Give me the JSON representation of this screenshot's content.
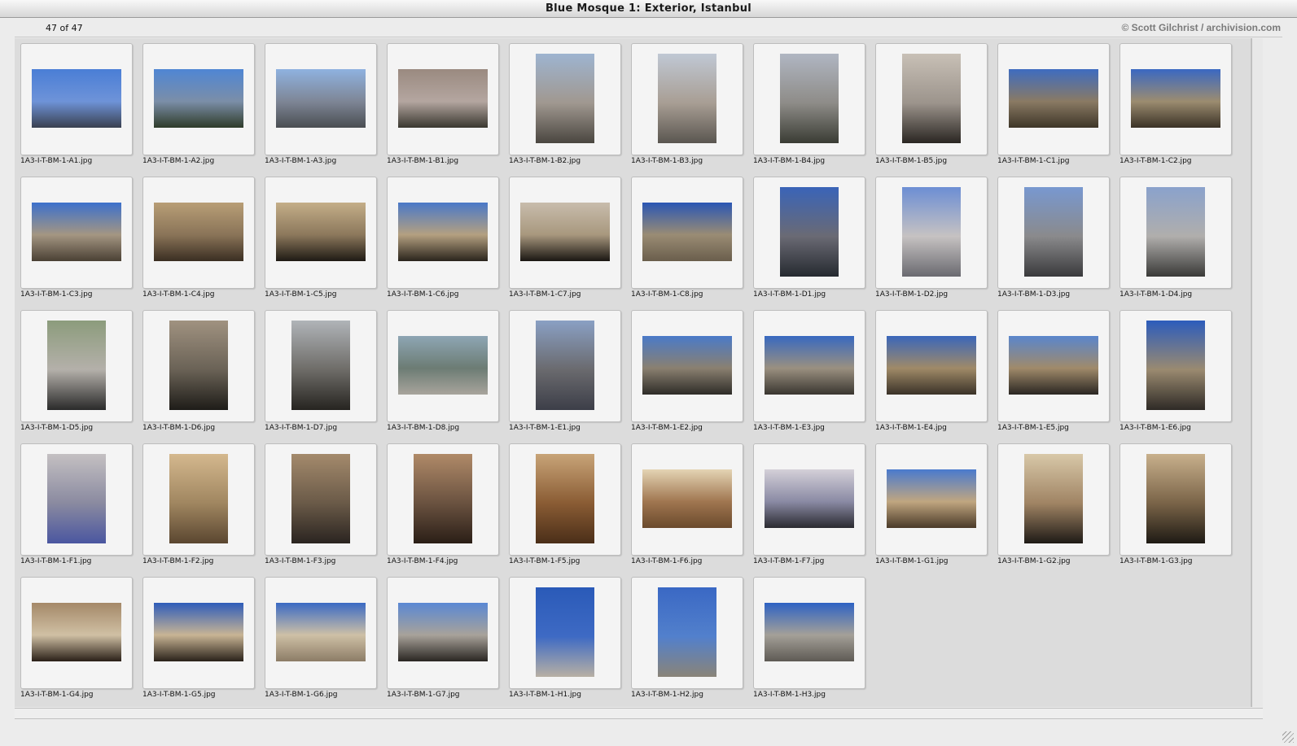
{
  "window": {
    "title": "Blue Mosque 1: Exterior, Istanbul"
  },
  "info": {
    "count": "47 of 47",
    "credit": "© Scott Gilchrist / archivision.com"
  },
  "colors": {
    "sky_blue": "#3f6fc4",
    "stone": "#b09a78",
    "shadow": "#2e2a24",
    "pale_sky": "#a8c4e0"
  },
  "thumbnails": [
    {
      "file": "1A3-I-T-BM-1-A1.jpg",
      "orientation": "landscape",
      "palette": [
        "#4a7ed6",
        "#6e93d8",
        "#3a4050"
      ]
    },
    {
      "file": "1A3-I-T-BM-1-A2.jpg",
      "orientation": "landscape",
      "palette": [
        "#4f86d4",
        "#7b8ea8",
        "#2f3c2a"
      ]
    },
    {
      "file": "1A3-I-T-BM-1-A3.jpg",
      "orientation": "landscape",
      "palette": [
        "#8fb2e0",
        "#7e8696",
        "#4a4e52"
      ]
    },
    {
      "file": "1A3-I-T-BM-1-B1.jpg",
      "orientation": "landscape",
      "palette": [
        "#9a8a80",
        "#b4a6a0",
        "#3a3830"
      ]
    },
    {
      "file": "1A3-I-T-BM-1-B2.jpg",
      "orientation": "portrait",
      "palette": [
        "#9eb4d0",
        "#a09890",
        "#4a4640"
      ]
    },
    {
      "file": "1A3-I-T-BM-1-B3.jpg",
      "orientation": "portrait",
      "palette": [
        "#c0c8d4",
        "#a89e94",
        "#5a5650"
      ]
    },
    {
      "file": "1A3-I-T-BM-1-B4.jpg",
      "orientation": "portrait",
      "palette": [
        "#b0b6c2",
        "#8e8c88",
        "#3a3c34"
      ]
    },
    {
      "file": "1A3-I-T-BM-1-B5.jpg",
      "orientation": "portrait",
      "palette": [
        "#c8c0b6",
        "#9c948c",
        "#2a2622"
      ]
    },
    {
      "file": "1A3-I-T-BM-1-C1.jpg",
      "orientation": "landscape",
      "palette": [
        "#3e6cc0",
        "#8a7a64",
        "#3e3628"
      ]
    },
    {
      "file": "1A3-I-T-BM-1-C2.jpg",
      "orientation": "landscape",
      "palette": [
        "#3a68c2",
        "#9c8c70",
        "#3a3226"
      ]
    },
    {
      "file": "1A3-I-T-BM-1-C3.jpg",
      "orientation": "landscape",
      "palette": [
        "#3c70cc",
        "#a49682",
        "#4a4034"
      ]
    },
    {
      "file": "1A3-I-T-BM-1-C4.jpg",
      "orientation": "landscape",
      "palette": [
        "#b89e76",
        "#8a7458",
        "#3a2e22"
      ]
    },
    {
      "file": "1A3-I-T-BM-1-C5.jpg",
      "orientation": "landscape",
      "palette": [
        "#c4ae88",
        "#8c785c",
        "#1e1a14"
      ]
    },
    {
      "file": "1A3-I-T-BM-1-C6.jpg",
      "orientation": "landscape",
      "palette": [
        "#4a78c8",
        "#b4a080",
        "#2a241c"
      ]
    },
    {
      "file": "1A3-I-T-BM-1-C7.jpg",
      "orientation": "landscape",
      "palette": [
        "#c8bcac",
        "#a8987e",
        "#1a1612"
      ]
    },
    {
      "file": "1A3-I-T-BM-1-C8.jpg",
      "orientation": "landscape",
      "palette": [
        "#2a56b4",
        "#9a8c74",
        "#6a5e4c"
      ]
    },
    {
      "file": "1A3-I-T-BM-1-D1.jpg",
      "orientation": "portrait",
      "palette": [
        "#3a64b8",
        "#6a6a74",
        "#262a30"
      ]
    },
    {
      "file": "1A3-I-T-BM-1-D2.jpg",
      "orientation": "portrait",
      "palette": [
        "#6c8ed4",
        "#c6c2c2",
        "#6a6a70"
      ]
    },
    {
      "file": "1A3-I-T-BM-1-D3.jpg",
      "orientation": "portrait",
      "palette": [
        "#7898d0",
        "#8a8a8c",
        "#3a3a3c"
      ]
    },
    {
      "file": "1A3-I-T-BM-1-D4.jpg",
      "orientation": "portrait",
      "palette": [
        "#8aa2cc",
        "#b0aeac",
        "#3a3a38"
      ]
    },
    {
      "file": "1A3-I-T-BM-1-D5.jpg",
      "orientation": "portrait",
      "palette": [
        "#8c9c7c",
        "#b4b0aa",
        "#2a2a2a"
      ]
    },
    {
      "file": "1A3-I-T-BM-1-D6.jpg",
      "orientation": "portrait",
      "palette": [
        "#a09280",
        "#6a6256",
        "#1e1c18"
      ]
    },
    {
      "file": "1A3-I-T-BM-1-D7.jpg",
      "orientation": "portrait",
      "palette": [
        "#b0b4b8",
        "#6e6c68",
        "#262420"
      ]
    },
    {
      "file": "1A3-I-T-BM-1-D8.jpg",
      "orientation": "landscape",
      "palette": [
        "#8ea6b4",
        "#6c7c74",
        "#a8a49c"
      ]
    },
    {
      "file": "1A3-I-T-BM-1-E1.jpg",
      "orientation": "portrait",
      "palette": [
        "#8aa0c4",
        "#6a6a6e",
        "#3c3e48"
      ]
    },
    {
      "file": "1A3-I-T-BM-1-E2.jpg",
      "orientation": "landscape",
      "palette": [
        "#4a7ac8",
        "#8a8070",
        "#2e2c28"
      ]
    },
    {
      "file": "1A3-I-T-BM-1-E3.jpg",
      "orientation": "landscape",
      "palette": [
        "#3868c0",
        "#9a9080",
        "#3a3630"
      ]
    },
    {
      "file": "1A3-I-T-BM-1-E4.jpg",
      "orientation": "landscape",
      "palette": [
        "#3a66ba",
        "#a08a68",
        "#3a3228"
      ]
    },
    {
      "file": "1A3-I-T-BM-1-E5.jpg",
      "orientation": "landscape",
      "palette": [
        "#5a86cc",
        "#a08a6a",
        "#2a2622"
      ]
    },
    {
      "file": "1A3-I-T-BM-1-E6.jpg",
      "orientation": "portrait",
      "palette": [
        "#2c5cbc",
        "#9a8a70",
        "#2e2a26"
      ]
    },
    {
      "file": "1A3-I-T-BM-1-F1.jpg",
      "orientation": "portrait",
      "palette": [
        "#c4c0c2",
        "#8a8aa0",
        "#4a56a0"
      ]
    },
    {
      "file": "1A3-I-T-BM-1-F2.jpg",
      "orientation": "portrait",
      "palette": [
        "#d4b88e",
        "#a08660",
        "#5a4630"
      ]
    },
    {
      "file": "1A3-I-T-BM-1-F3.jpg",
      "orientation": "portrait",
      "palette": [
        "#a48a6c",
        "#6a5a48",
        "#2a2420"
      ]
    },
    {
      "file": "1A3-I-T-BM-1-F4.jpg",
      "orientation": "portrait",
      "palette": [
        "#b08a68",
        "#6a5240",
        "#2a1e16"
      ]
    },
    {
      "file": "1A3-I-T-BM-1-F5.jpg",
      "orientation": "portrait",
      "palette": [
        "#c8a478",
        "#8a5c34",
        "#4a2e18"
      ]
    },
    {
      "file": "1A3-I-T-BM-1-F6.jpg",
      "orientation": "landscape",
      "palette": [
        "#e4d4b4",
        "#a07650",
        "#6a4a2c"
      ]
    },
    {
      "file": "1A3-I-T-BM-1-F7.jpg",
      "orientation": "landscape",
      "palette": [
        "#d4d0d8",
        "#8a8aa4",
        "#2a2a30"
      ]
    },
    {
      "file": "1A3-I-T-BM-1-G1.jpg",
      "orientation": "landscape",
      "palette": [
        "#4a7ace",
        "#c0a680",
        "#4a3a28"
      ]
    },
    {
      "file": "1A3-I-T-BM-1-G2.jpg",
      "orientation": "portrait",
      "palette": [
        "#d8c8a8",
        "#a08464",
        "#1e1a16"
      ]
    },
    {
      "file": "1A3-I-T-BM-1-G3.jpg",
      "orientation": "portrait",
      "palette": [
        "#c8b08c",
        "#7a6448",
        "#1e1a14"
      ]
    },
    {
      "file": "1A3-I-T-BM-1-G4.jpg",
      "orientation": "landscape",
      "palette": [
        "#a48868",
        "#d0c0a4",
        "#2a2018"
      ]
    },
    {
      "file": "1A3-I-T-BM-1-G5.jpg",
      "orientation": "landscape",
      "palette": [
        "#2e5cba",
        "#c8b494",
        "#2a221a"
      ]
    },
    {
      "file": "1A3-I-T-BM-1-G6.jpg",
      "orientation": "landscape",
      "palette": [
        "#3a6ac4",
        "#cec0a6",
        "#8c7c66"
      ]
    },
    {
      "file": "1A3-I-T-BM-1-G7.jpg",
      "orientation": "landscape",
      "palette": [
        "#5a88d4",
        "#a8a29a",
        "#2a2622"
      ]
    },
    {
      "file": "1A3-I-T-BM-1-H1.jpg",
      "orientation": "portrait",
      "palette": [
        "#2a5ab8",
        "#3e6ac4",
        "#b8b0a4"
      ]
    },
    {
      "file": "1A3-I-T-BM-1-H2.jpg",
      "orientation": "portrait",
      "palette": [
        "#3a68c4",
        "#5280cc",
        "#8a8478"
      ]
    },
    {
      "file": "1A3-I-T-BM-1-H3.jpg",
      "orientation": "landscape",
      "palette": [
        "#2e62c4",
        "#a4a098",
        "#5e5a54"
      ]
    }
  ]
}
